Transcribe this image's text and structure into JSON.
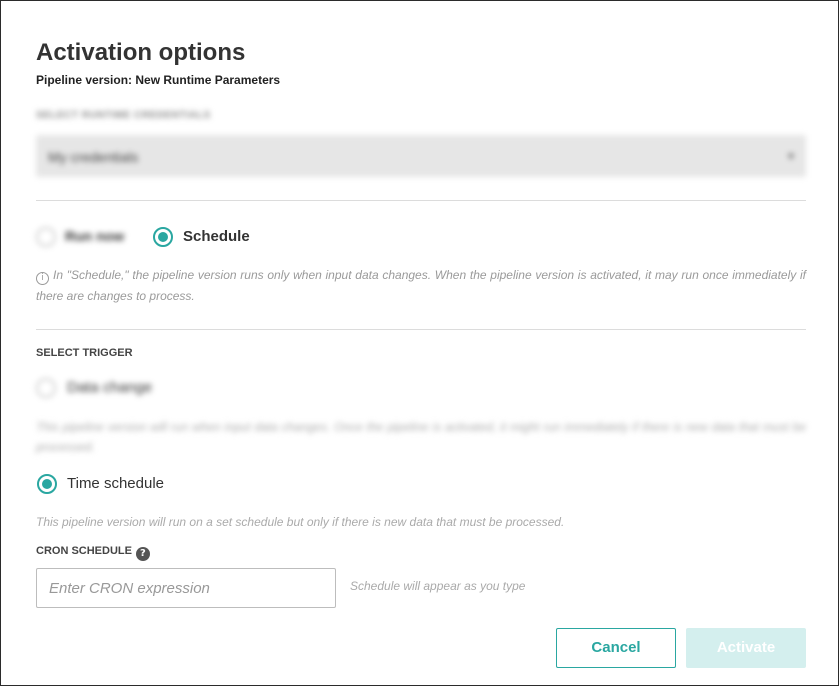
{
  "dialog": {
    "title": "Activation options",
    "subtitle": "Pipeline version: New Runtime Parameters"
  },
  "runtime": {
    "label": "SELECT RUNTIME CREDENTIALS",
    "selected": "My credentials"
  },
  "mode": {
    "run_now_label": "Run now",
    "schedule_label": "Schedule",
    "selected": "Schedule",
    "info_text": "In \"Schedule,\" the pipeline version runs only when input data changes. When the pipeline version is activated, it may run once immediately if there are changes to process."
  },
  "trigger": {
    "section_label": "SELECT TRIGGER",
    "data_change_label": "Data change",
    "data_change_desc": "This pipeline version will run when input data changes. Once the pipeline is activated, it might run immediately if there is new data that must be processed.",
    "time_schedule_label": "Time schedule",
    "time_schedule_desc": "This pipeline version will run on a set schedule but only if there is new data that must be processed.",
    "selected": "Time schedule"
  },
  "cron": {
    "label": "CRON SCHEDULE",
    "placeholder": "Enter CRON expression",
    "value": "",
    "hint": "Schedule will appear as you type"
  },
  "buttons": {
    "cancel": "Cancel",
    "activate": "Activate"
  },
  "colors": {
    "accent": "#2aa7a1",
    "disabled_button": "#d4efee"
  },
  "icons": {
    "info": "info-icon",
    "help": "help-icon",
    "dropdown": "chevron-down-icon"
  }
}
